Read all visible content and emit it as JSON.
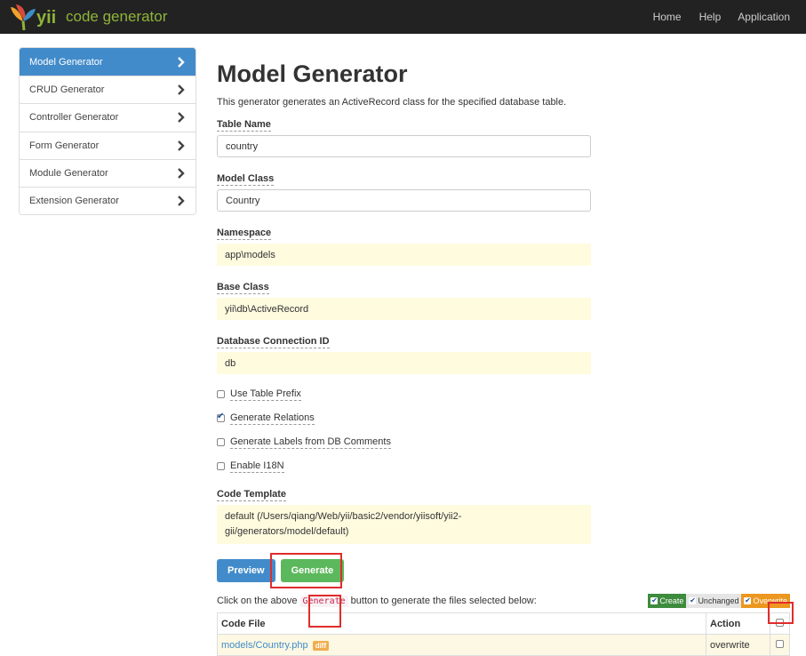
{
  "navbar": {
    "brand": "code generator",
    "logo_text": "yii",
    "links": [
      "Home",
      "Help",
      "Application"
    ]
  },
  "sidebar": {
    "items": [
      {
        "label": "Model Generator",
        "active": true
      },
      {
        "label": "CRUD Generator",
        "active": false
      },
      {
        "label": "Controller Generator",
        "active": false
      },
      {
        "label": "Form Generator",
        "active": false
      },
      {
        "label": "Module Generator",
        "active": false
      },
      {
        "label": "Extension Generator",
        "active": false
      }
    ]
  },
  "main": {
    "title": "Model Generator",
    "description": "This generator generates an ActiveRecord class for the specified database table.",
    "fields": {
      "table_name": {
        "label": "Table Name",
        "value": "country"
      },
      "model_class": {
        "label": "Model Class",
        "value": "Country"
      },
      "namespace": {
        "label": "Namespace",
        "value": "app\\models"
      },
      "base_class": {
        "label": "Base Class",
        "value": "yii\\db\\ActiveRecord"
      },
      "db_connection": {
        "label": "Database Connection ID",
        "value": "db"
      },
      "code_template": {
        "label": "Code Template",
        "value": "default (/Users/qiang/Web/yii/basic2/vendor/yiisoft/yii2-gii/generators/model/default)"
      }
    },
    "checkboxes": [
      {
        "label": "Use Table Prefix",
        "checked": false
      },
      {
        "label": "Generate Relations",
        "checked": true
      },
      {
        "label": "Generate Labels from DB Comments",
        "checked": false
      },
      {
        "label": "Enable I18N",
        "checked": false
      }
    ],
    "buttons": {
      "preview": "Preview",
      "generate": "Generate"
    },
    "hint": {
      "before": "Click on the above",
      "code": "Generate",
      "after": "button to generate the files selected below:"
    },
    "legend": {
      "create": "Create",
      "unchanged": "Unchanged",
      "overwrite": "Overwrite"
    },
    "table": {
      "headers": {
        "file": "Code File",
        "action": "Action"
      },
      "rows": [
        {
          "file": "models/Country.php",
          "diff": "diff",
          "action": "overwrite"
        }
      ]
    }
  },
  "colors": {
    "navbar_bg": "#222222",
    "active_item": "#428bca",
    "preview_btn": "#428bca",
    "generate_btn": "#5cb85c",
    "sticky_bg": "#fffbdf",
    "highlight_box": "#e02c2c"
  }
}
